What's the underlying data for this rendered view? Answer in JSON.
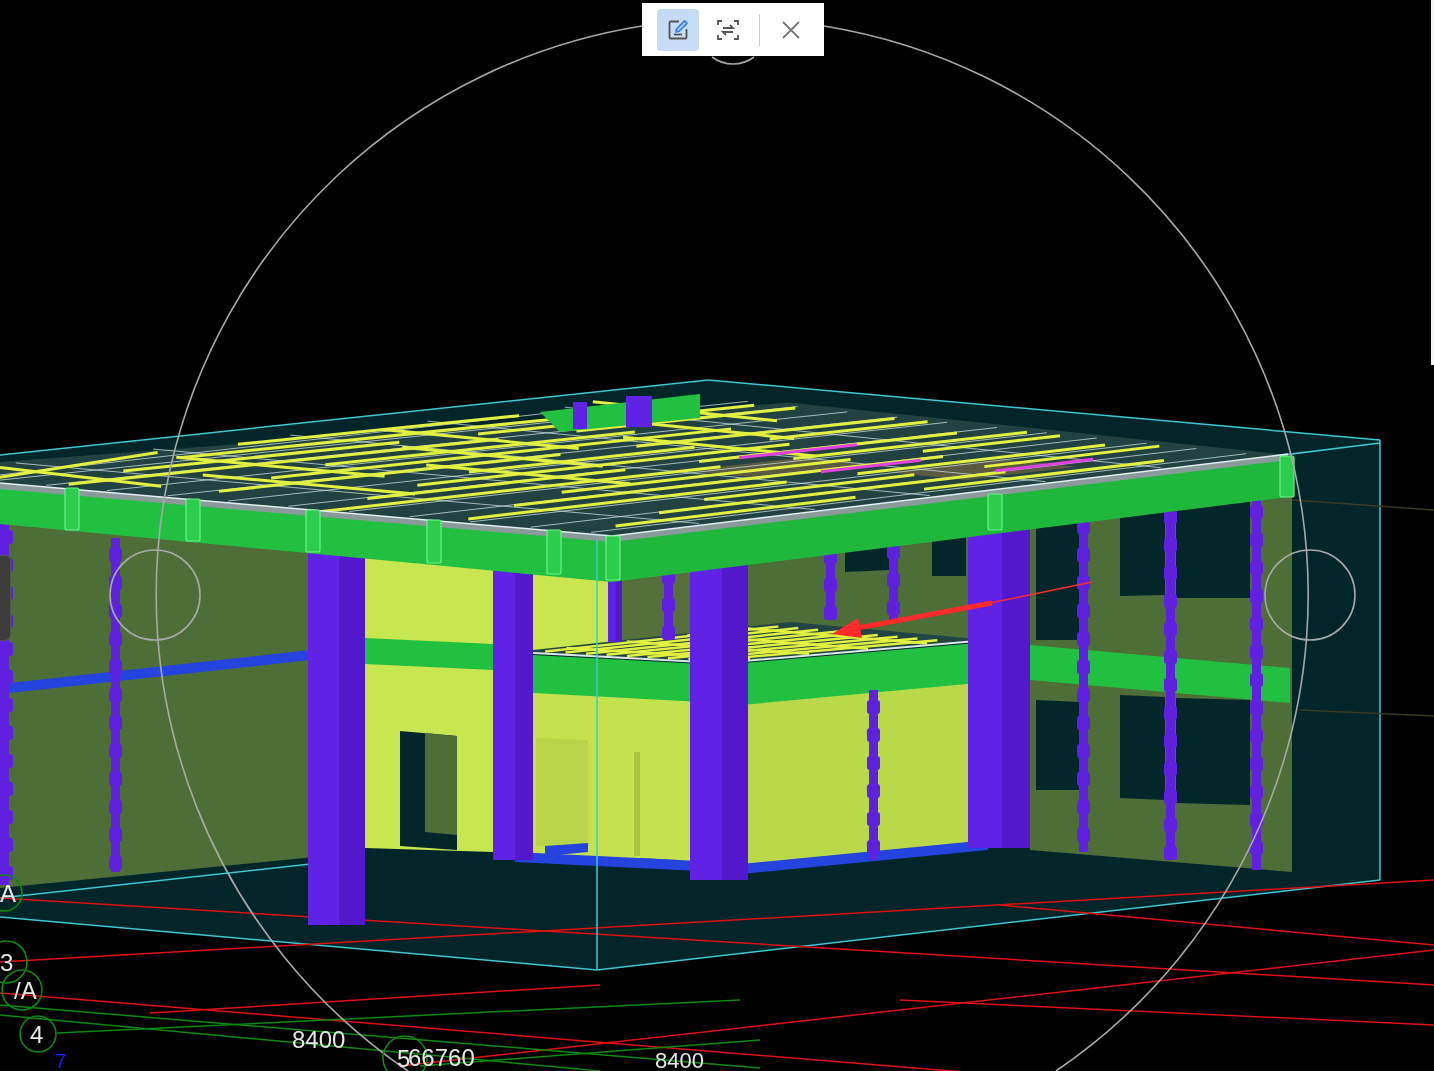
{
  "toolbar": {
    "buttons": [
      {
        "selected": true
      },
      {
        "selected": false
      },
      {
        "selected": false
      }
    ]
  },
  "axis_bubbles": [
    {
      "label": "A"
    },
    {
      "label": "3"
    },
    {
      "label": "/A"
    },
    {
      "label": "4"
    },
    {
      "label": "5"
    }
  ],
  "dimension_texts": [
    {
      "text": "7",
      "color": "#1a1aff"
    },
    {
      "text": "8400",
      "color": "#e6e6e6"
    },
    {
      "text": "66760",
      "color": "#e6e6e6"
    },
    {
      "text": "8400",
      "color": "#e6e6e6"
    }
  ]
}
